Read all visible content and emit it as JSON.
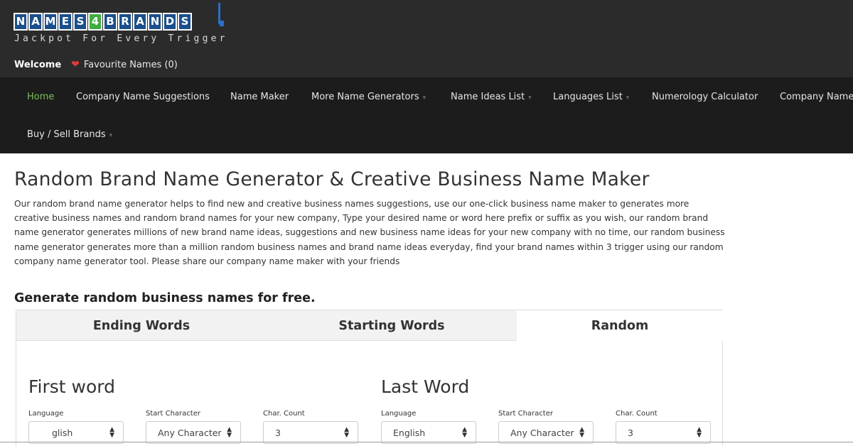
{
  "header": {
    "logo_letters": [
      "N",
      "A",
      "M",
      "E",
      "S",
      "4",
      "B",
      "R",
      "A",
      "N",
      "D",
      "S"
    ],
    "tagline": "Jackpot For Every Trigger",
    "welcome": "Welcome",
    "favourites": "Favourite Names (0)"
  },
  "nav": {
    "items": [
      "Home",
      "Company Name Suggestions",
      "Name Maker",
      "More Name Generators",
      "Name Ideas List",
      "Languages List",
      "Numerology Calculator",
      "Company Name",
      "Buy / Sell Brands"
    ]
  },
  "main": {
    "title": "Random Brand Name Generator & Creative Business Name Maker",
    "description": "Our random brand name generator helps to find new and creative business names suggestions, use our one-click business name maker to generates more creative business names and random brand names for your new company, Type your desired name or word here prefix or suffix as you wish, our random brand name generator generates millions of new brand name ideas, suggestions and new business name ideas for your new company with no time, our random business name generator generates more than a million random business names and brand name ideas everyday, find your brand names within 3 trigger using our random company name generator tool. Please share our company name maker with your friends",
    "subheading": "Generate random business names for free."
  },
  "tabs": [
    "Ending Words",
    "Starting Words",
    "Random"
  ],
  "first_word": {
    "title": "First word",
    "language_label": "Language",
    "language_value": "glish",
    "start_label": "Start Character",
    "start_value": "Any Character",
    "count_label": "Char. Count",
    "count_value": "3"
  },
  "last_word": {
    "title": "Last Word",
    "language_label": "Language",
    "language_value": "English",
    "start_label": "Start Character",
    "start_value": "Any Character",
    "count_label": "Char. Count",
    "count_value": "3"
  },
  "icons": {
    "heart": "heart-icon",
    "select_arrow": "up-down-arrows-icon",
    "nav_caret": "caret-icon"
  },
  "colors": {
    "header_bg": "#2b2b2b",
    "nav_bg": "#1c1c1c",
    "nav_active": "#7bbd5a",
    "logo_blue": "#1a4f8c",
    "logo_green": "#3fae3f",
    "heart": "#e23b3b"
  }
}
